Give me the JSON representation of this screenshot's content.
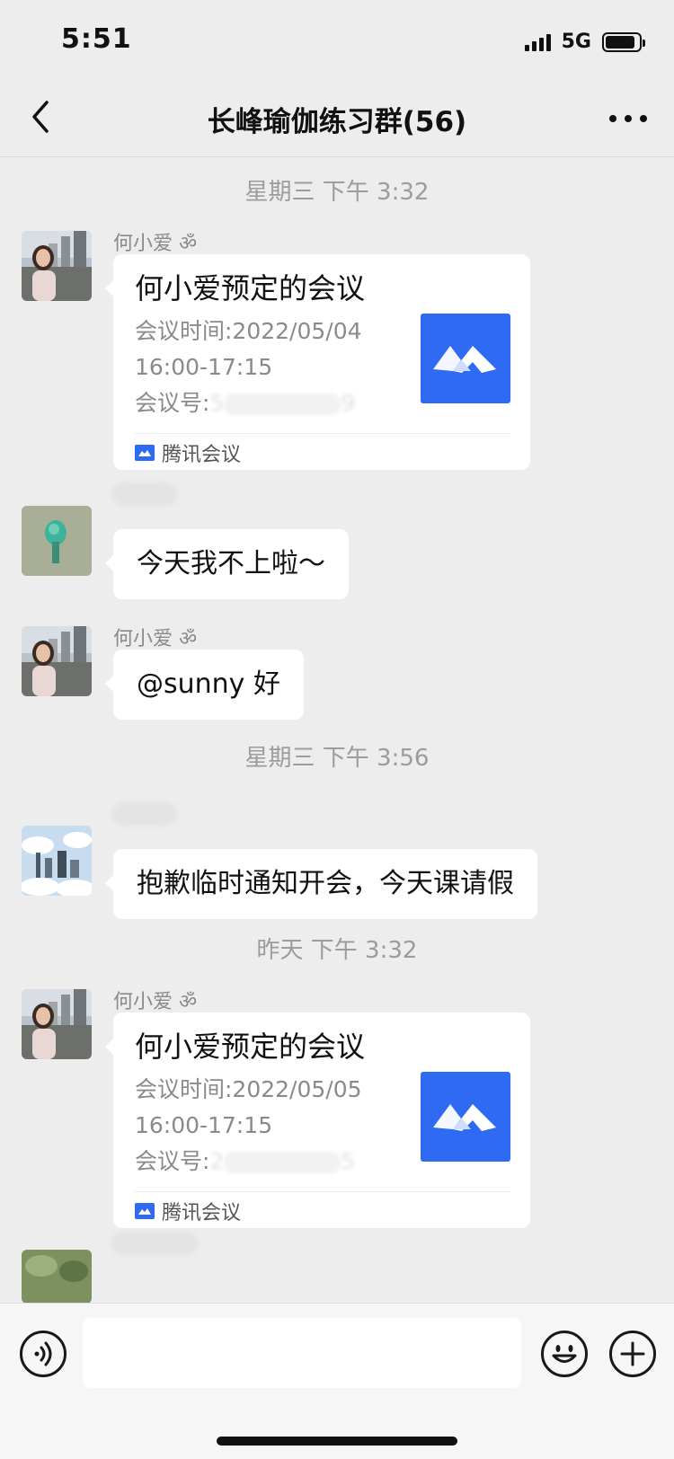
{
  "status_bar": {
    "time": "5:51",
    "network": "5G"
  },
  "header": {
    "title": "长峰瑜伽练习群(56)"
  },
  "chat": {
    "time_separators": [
      "星期三 下午 3:32",
      "星期三 下午 3:56",
      "昨天 下午 3:32"
    ],
    "meeting_card_1": {
      "sender": "何小爱 ॐ",
      "title": "何小爱预定的会议",
      "time_line_1": "会议时间:2022/05/04",
      "time_line_2": "16:00-17:15",
      "id_label": "会议号:",
      "id_visible_start": "5",
      "id_visible_end": "9",
      "source": "腾讯会议"
    },
    "message_2": {
      "text": "今天我不上啦～"
    },
    "message_3": {
      "sender": "何小爱 ॐ",
      "text": "@sunny 好"
    },
    "message_4": {
      "text": "抱歉临时通知开会，今天课请假"
    },
    "meeting_card_2": {
      "sender": "何小爱 ॐ",
      "title": "何小爱预定的会议",
      "time_line_1": "会议时间:2022/05/05",
      "time_line_2": "16:00-17:15",
      "id_label": "会议号:",
      "id_visible_start": "2",
      "id_visible_end": "5",
      "source": "腾讯会议"
    }
  },
  "icons": {
    "back": "chevron-left-icon",
    "more": "more-dots-icon",
    "voice": "voice-icon",
    "emoji": "emoji-icon",
    "plus": "plus-icon",
    "meeting_logo": "tencent-meeting-icon"
  },
  "colors": {
    "background": "#ededed",
    "bubble": "#ffffff",
    "meeting_brand": "#2f6bf2",
    "meta_text": "#9c9c9c"
  }
}
